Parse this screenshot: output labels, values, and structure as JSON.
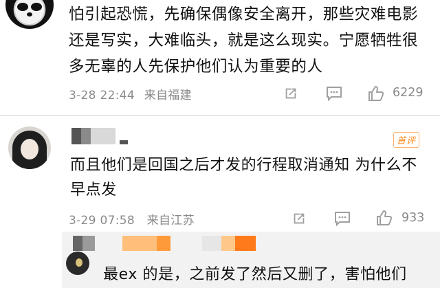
{
  "comments": [
    {
      "text": "怕引起恐慌，先确保偶像安全离开，那些灾难电影还是写实，大难临头，就是这么现实。宁愿牺牲很多无辜的人先保护他们认为重要的人",
      "time": "3-28 22:44",
      "location": "来自福建",
      "like_count": "6229",
      "icons": [
        "share-icon",
        "comment-icon",
        "like-icon"
      ]
    },
    {
      "badge": "首评",
      "text": "而且他们是回国之后才发的行程取消通知 为什么不早点发",
      "time": "3-29 07:58",
      "location": "来自江苏",
      "like_count": "933",
      "icons": [
        "share-icon",
        "comment-icon",
        "like-icon"
      ],
      "reply": {
        "text": "最ex 的是，之前发了然后又删了，害怕他们"
      }
    }
  ],
  "colors": {
    "text": "#111111",
    "meta": "#8a8a8a",
    "divider": "#e6e6e6",
    "badge": "#ff8a1f",
    "reply_bg": "#f2f2f2"
  }
}
